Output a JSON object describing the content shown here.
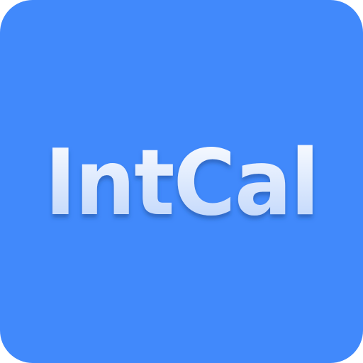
{
  "app_icon": {
    "wordmark": "IntCal",
    "colors": {
      "background": "#4189fb",
      "text_top": "#ffffff",
      "text_bottom": "#b9d2fb",
      "shadow": "#1f4f9a"
    }
  }
}
